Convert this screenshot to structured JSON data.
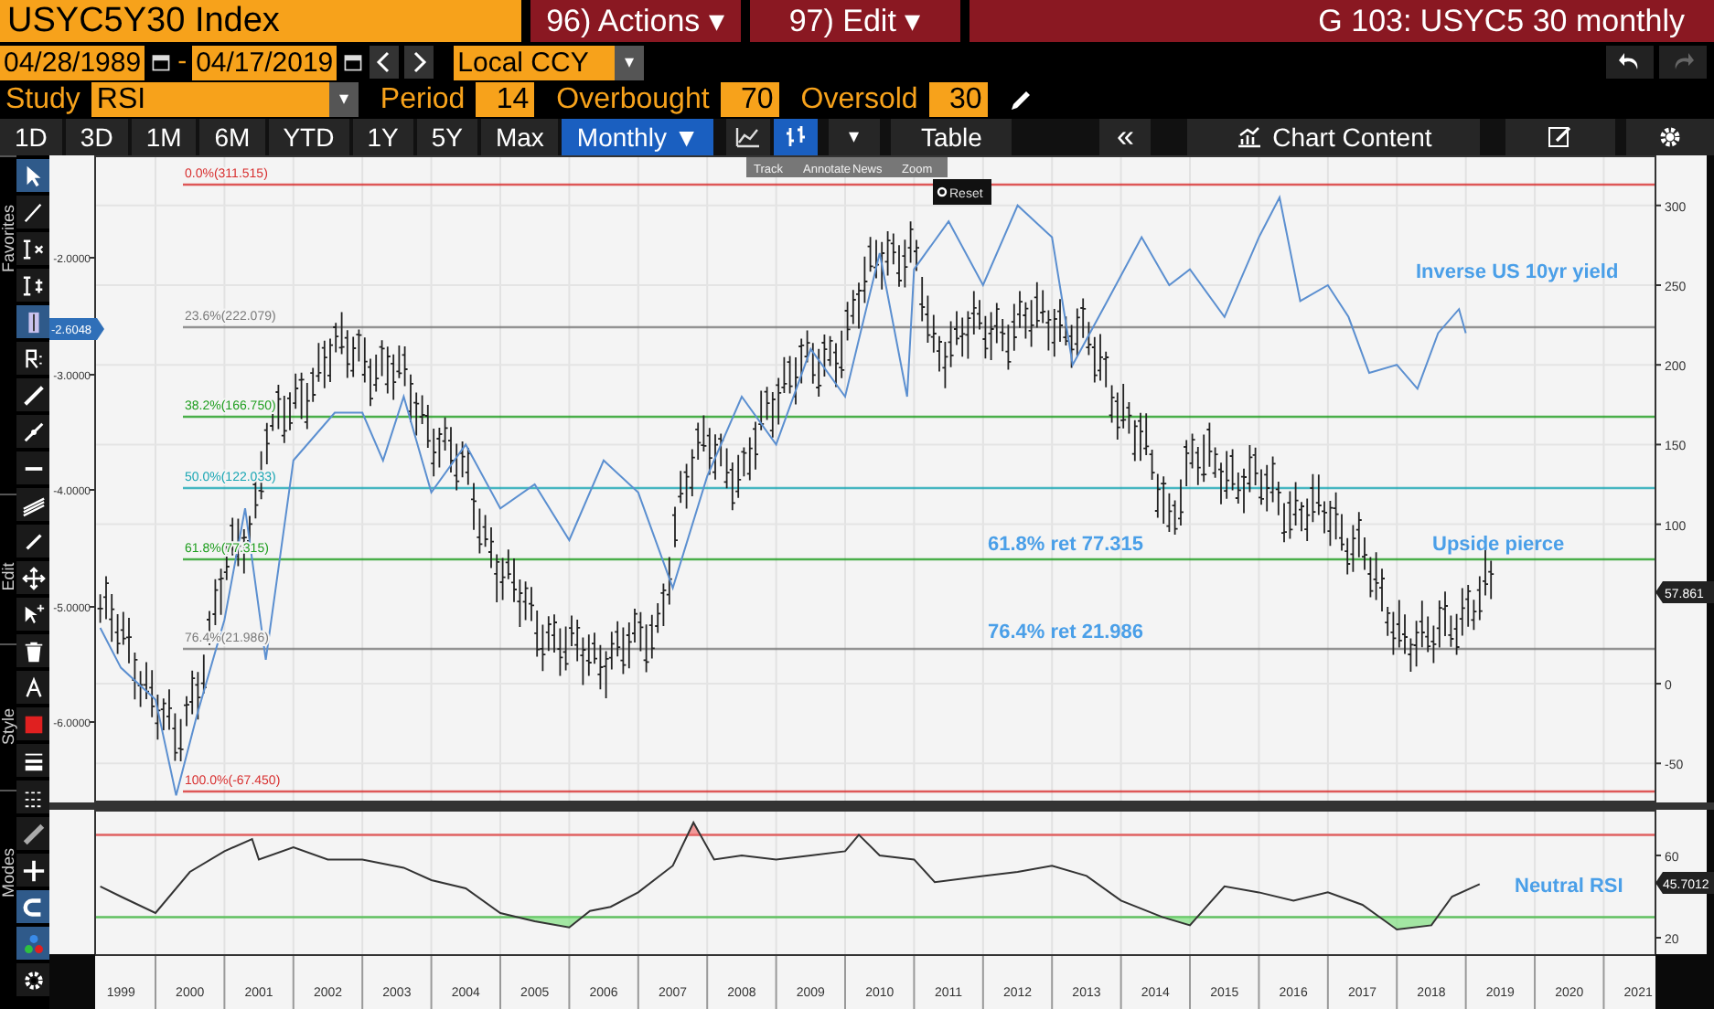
{
  "header": {
    "ticker": "USYC5Y30 Index",
    "menus": [
      "96) Actions ▾",
      "97) Edit ▾"
    ],
    "title": "G 103: USYC5 30 monthly"
  },
  "range_bar": {
    "start_date": "04/28/1989",
    "separator": "-",
    "end_date": "04/17/2019",
    "currency": "Local CCY",
    "currency_caret": "▾"
  },
  "study_bar": {
    "study_label": "Study",
    "study": "RSI",
    "study_caret": "▾",
    "fields": [
      {
        "label": "Period",
        "value": "14"
      },
      {
        "label": "Overbought",
        "value": "70"
      },
      {
        "label": "Oversold",
        "value": "30"
      }
    ]
  },
  "period_tabs": [
    {
      "label": "1D",
      "selected": false
    },
    {
      "label": "3D",
      "selected": false
    },
    {
      "label": "1M",
      "selected": false
    },
    {
      "label": "6M",
      "selected": false
    },
    {
      "label": "YTD",
      "selected": false
    },
    {
      "label": "1Y",
      "selected": false
    },
    {
      "label": "5Y",
      "selected": false
    },
    {
      "label": "Max",
      "selected": false
    },
    {
      "label": "Monthly ▼",
      "selected": true
    }
  ],
  "chart_type_buttons": [
    {
      "kind": "line",
      "selected": false
    },
    {
      "kind": "bar",
      "selected": true
    }
  ],
  "toolbar": {
    "caret": "▾",
    "table": "Table",
    "collapse": "«",
    "chart_content": "Chart Content"
  },
  "side_toolbar": {
    "sections": [
      "Favorites",
      "Edit",
      "Style",
      "Modes"
    ],
    "tools": [
      {
        "selected": true
      },
      {
        "selected": false
      },
      {
        "selected": false
      },
      {
        "selected": false
      },
      {
        "selected": true
      },
      {
        "selected": false
      },
      {
        "selected": false
      },
      {
        "selected": false
      },
      {
        "selected": false
      },
      {
        "selected": false
      },
      {
        "selected": false
      },
      {
        "selected": false
      },
      {
        "selected": false
      },
      {
        "selected": false
      },
      {
        "selected": false
      },
      {
        "selected": false
      },
      {
        "selected": false
      },
      {
        "selected": false
      },
      {
        "selected": false
      },
      {
        "selected": false
      },
      {
        "selected": true
      },
      {
        "selected": true
      },
      {
        "selected": false
      }
    ]
  },
  "chart_tools": [
    "Track",
    "Annotate",
    "News",
    "Zoom"
  ],
  "reset": "Reset",
  "price_panel": {
    "left_ticks": [
      "-2.0000",
      "-3.0000",
      "-4.0000",
      "-5.0000",
      "-6.0000"
    ],
    "left_tag": "-2.6048",
    "last_tag": "57.861",
    "fib_levels": [
      {
        "label": "0.0%(311.515)",
        "color": "#d83030"
      },
      {
        "label": "23.6%(222.079)",
        "color": "#7a7a7a"
      },
      {
        "label": "38.2%(166.750)",
        "color": "#1f9e1f"
      },
      {
        "label": "50.0%(122.033)",
        "color": "#1aa6b4"
      },
      {
        "label": "61.8%(77.315)",
        "color": "#1f9e1f"
      },
      {
        "label": "76.4%(21.986)",
        "color": "#7a7a7a"
      },
      {
        "label": "100.0%(-67.450)",
        "color": "#d83030"
      }
    ],
    "annotations": [
      "Inverse US 10yr yield",
      "61.8% ret 77.315",
      "Upside pierce",
      "76.4% ret 21.986"
    ],
    "chart_data": {
      "type": "line",
      "xlim": [
        1999.125,
        2021.75
      ],
      "ylim": [
        -74.5,
        331.4
      ],
      "yticks": [
        300,
        250,
        200,
        150,
        100,
        0,
        -50
      ],
      "x": [
        1999.2,
        1999.5,
        2000,
        2000.3,
        2000.6,
        2001,
        2001.3,
        2001.6,
        2002,
        2002.6,
        2003,
        2003.3,
        2003.6,
        2004,
        2004.5,
        2005,
        2005.5,
        2006,
        2006.5,
        2007,
        2007.5,
        2008,
        2008.5,
        2009,
        2009.5,
        2010,
        2010.5,
        2010.9,
        2011,
        2011.5,
        2012,
        2012.5,
        2013,
        2013.3,
        2013.8,
        2014.3,
        2014.7,
        2015,
        2015.5,
        2016,
        2016.3,
        2016.6,
        2017,
        2017.3,
        2017.6,
        2018,
        2018.3,
        2018.6,
        2018.9,
        2019
      ],
      "series": [
        {
          "color": "#5b8fd0",
          "values": [
            35,
            10,
            -10,
            -70,
            -20,
            40,
            110,
            15,
            140,
            170,
            170,
            140,
            180,
            120,
            150,
            110,
            125,
            90,
            140,
            120,
            60,
            130,
            180,
            150,
            210,
            180,
            270,
            180,
            260,
            290,
            250,
            300,
            280,
            200,
            240,
            280,
            250,
            260,
            230,
            280,
            305,
            240,
            250,
            230,
            195,
            200,
            185,
            220,
            235,
            220
          ]
        }
      ]
    }
  },
  "rsi_panel": {
    "last_tag": "45.7012",
    "annotation": "Neutral RSI",
    "chart_data": {
      "type": "line",
      "xlim": [
        1999.125,
        2021.75
      ],
      "ylim": [
        12,
        82.2
      ],
      "yticks": [
        60,
        20
      ],
      "xticks": [
        {
          "value": 1999.5,
          "label": "1999"
        },
        {
          "value": 2000.5,
          "label": "2000"
        },
        {
          "value": 2001.5,
          "label": "2001"
        },
        {
          "value": 2002.5,
          "label": "2002"
        },
        {
          "value": 2003.5,
          "label": "2003"
        },
        {
          "value": 2004.5,
          "label": "2004"
        },
        {
          "value": 2005.5,
          "label": "2005"
        },
        {
          "value": 2006.5,
          "label": "2006"
        },
        {
          "value": 2007.5,
          "label": "2007"
        },
        {
          "value": 2008.5,
          "label": "2008"
        },
        {
          "value": 2009.5,
          "label": "2009"
        },
        {
          "value": 2010.5,
          "label": "2010"
        },
        {
          "value": 2011.5,
          "label": "2011"
        },
        {
          "value": 2012.5,
          "label": "2012"
        },
        {
          "value": 2013.5,
          "label": "2013"
        },
        {
          "value": 2014.5,
          "label": "2014"
        },
        {
          "value": 2015.5,
          "label": "2015"
        },
        {
          "value": 2016.5,
          "label": "2016"
        },
        {
          "value": 2017.5,
          "label": "2017"
        },
        {
          "value": 2018.5,
          "label": "2018"
        },
        {
          "value": 2019.5,
          "label": "2019"
        },
        {
          "value": 2020.5,
          "label": "2020"
        },
        {
          "value": 2021.5,
          "label": "2021"
        }
      ],
      "x": [
        1999.2,
        1999.5,
        2000,
        2000.5,
        2001,
        2001.4,
        2001.5,
        2002,
        2002.5,
        2003,
        2003.6,
        2004,
        2004.5,
        2005,
        2005.5,
        2006,
        2006.3,
        2006.6,
        2007,
        2007.5,
        2007.8,
        2008.1,
        2008.5,
        2009,
        2009.5,
        2010,
        2010.2,
        2010.5,
        2011,
        2011.3,
        2012,
        2012.5,
        2013,
        2013.5,
        2014,
        2014.6,
        2015,
        2015.5,
        2016,
        2016.5,
        2017,
        2017.5,
        2018,
        2018.5,
        2018.8,
        2019.2
      ],
      "series": [
        {
          "color": "#333333",
          "values": [
            45,
            40,
            32,
            52,
            62,
            68,
            58,
            64,
            58,
            58,
            54,
            48,
            44,
            32,
            28,
            25,
            33,
            35,
            42,
            55,
            76,
            58,
            60,
            58,
            60,
            62,
            70,
            60,
            58,
            47,
            50,
            52,
            55,
            50,
            38,
            30,
            26,
            45,
            42,
            38,
            42,
            36,
            24,
            26,
            40,
            46
          ]
        }
      ]
    }
  }
}
